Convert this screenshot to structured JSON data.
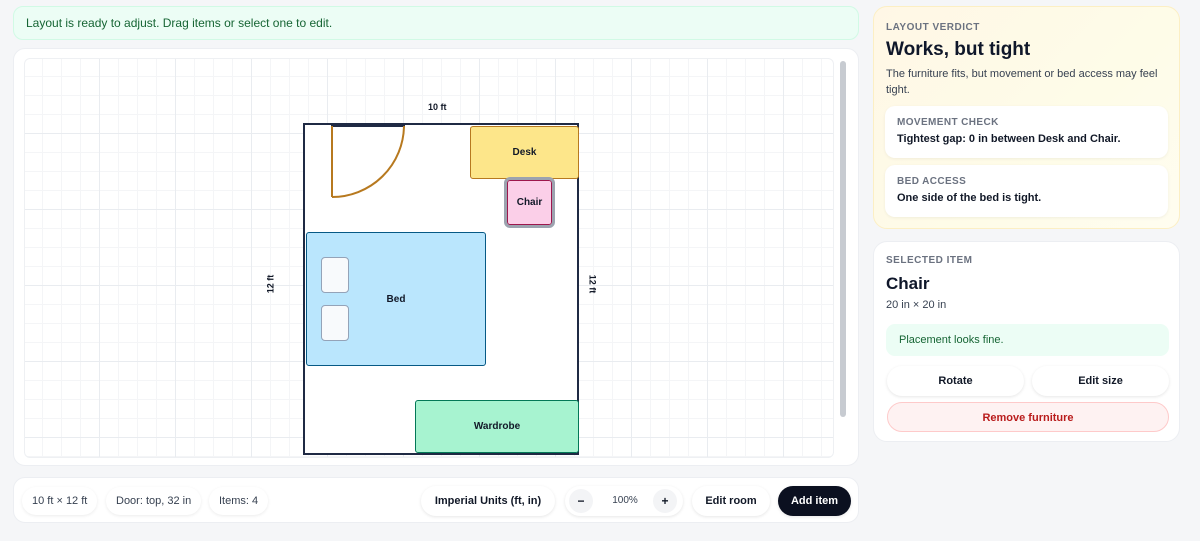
{
  "status": {
    "message": "Layout is ready to adjust. Drag items or select one to edit."
  },
  "canvas": {
    "dims": {
      "top": "10 ft",
      "left": "12 ft",
      "right": "12 ft"
    },
    "furniture": {
      "desk": "Desk",
      "chair": "Chair",
      "bed": "Bed",
      "wardrobe": "Wardrobe"
    }
  },
  "toolbar": {
    "room_size": "10 ft × 12 ft",
    "door": "Door: top, 32 in",
    "items": "Items: 4",
    "units_label": "Imperial Units (ft, in)",
    "zoom_out": "−",
    "zoom_value": "100%",
    "zoom_in": "+",
    "edit_room": "Edit room",
    "add_item": "Add item"
  },
  "verdict": {
    "label": "LAYOUT VERDICT",
    "title": "Works, but tight",
    "description": "The furniture fits, but movement or bed access may feel tight.",
    "movement": {
      "label": "MOVEMENT CHECK",
      "text": "Tightest gap: 0 in between Desk and Chair."
    },
    "access": {
      "label": "BED ACCESS",
      "text": "One side of the bed is tight."
    }
  },
  "selected": {
    "label": "SELECTED ITEM",
    "name": "Chair",
    "size": "20 in × 20 in",
    "note": "Placement looks fine.",
    "rotate": "Rotate",
    "edit_size": "Edit size",
    "remove": "Remove furniture"
  },
  "colors": {
    "desk": "#fde68a",
    "chair": "#fbcfe8",
    "bed": "#bae6fd",
    "wardrobe": "#a7f3d0",
    "primary_button": "#0b1020",
    "success_bg": "#ecfdf5",
    "danger_text": "#b91c1c"
  }
}
